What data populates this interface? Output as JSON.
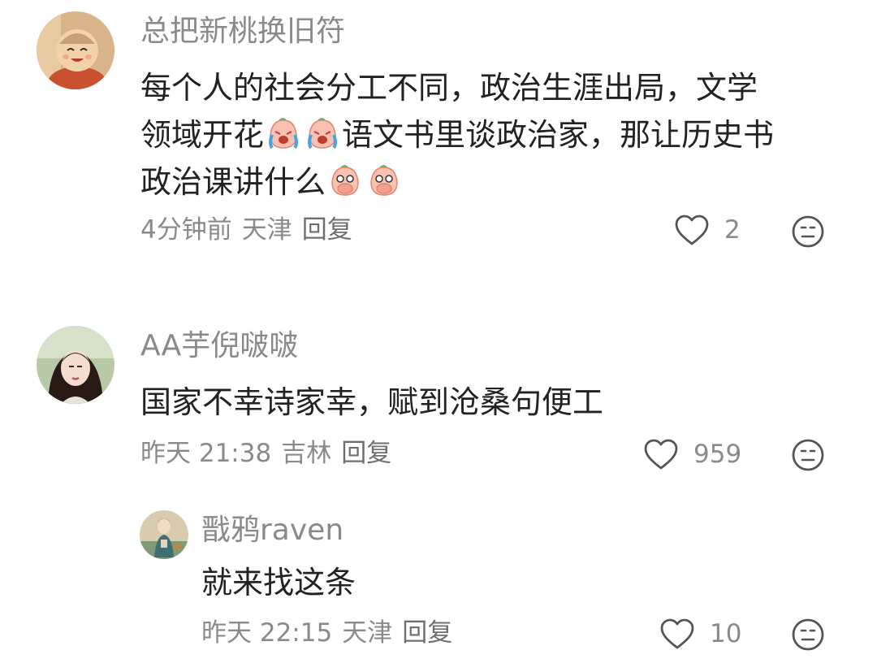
{
  "comments": [
    {
      "username": "总把新桃换旧符",
      "line1": "每个人的社会分工不同，政治生涯出局，文学",
      "line2_a": "领域开花",
      "line2_b": "语文书里谈政治家，那让历史书",
      "line3": "政治课讲什么",
      "emoji_crying": "crying-face-emoji",
      "emoji_shocked": "covering-mouth-emoji",
      "time": "4分钟前",
      "location": "天津",
      "reply_label": "回复",
      "likes": "2"
    },
    {
      "username": "AA芋倪啵啵",
      "text": "国家不幸诗家幸，赋到沧桑句便工",
      "time": "昨天 21:38",
      "location": "吉林",
      "reply_label": "回复",
      "likes": "959"
    },
    {
      "username": "戬鸦raven",
      "text": "就来找这条",
      "time": "昨天 22:15",
      "location": "天津",
      "reply_label": "回复",
      "likes": "10"
    }
  ],
  "icons": {
    "like": "heart-outline-icon",
    "dislike": "meh-face-icon"
  },
  "colors": {
    "text": "#222222",
    "meta": "#8a8a8a",
    "icon": "#555555"
  }
}
